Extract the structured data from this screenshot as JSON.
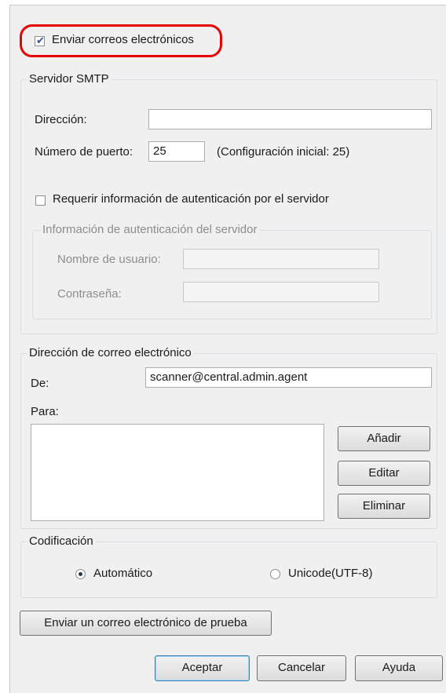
{
  "send_emails": {
    "label": "Enviar correos electrónicos",
    "checked": true
  },
  "smtp": {
    "title": "Servidor SMTP",
    "address_label": "Dirección:",
    "address_value": "",
    "port_label": "Número de puerto:",
    "port_value": "25",
    "port_hint": "(Configuración inicial: 25)",
    "require_auth_label": "Requerir información de autenticación por el servidor",
    "require_auth_checked": false,
    "auth": {
      "title": "Información de autenticación del servidor",
      "username_label": "Nombre de usuario:",
      "username_value": "",
      "password_label": "Contraseña:",
      "password_value": ""
    }
  },
  "email": {
    "title": "Dirección de correo electrónico",
    "from_label": "De:",
    "from_value": "scanner@central.admin.agent",
    "to_label": "Para:",
    "to_items": [],
    "add_button": "Añadir",
    "edit_button": "Editar",
    "delete_button": "Eliminar"
  },
  "encoding": {
    "title": "Codificación",
    "options": [
      {
        "label": "Automático",
        "selected": true
      },
      {
        "label": "Unicode(UTF-8)",
        "selected": false
      }
    ]
  },
  "test_button": "Enviar un correo electrónico de prueba",
  "footer": {
    "ok": "Aceptar",
    "cancel": "Cancelar",
    "help": "Ayuda"
  },
  "colors": {
    "highlight": "#e60000",
    "dialog_bg": "#f0f0f0",
    "default_button_border": "#3c7fb1"
  }
}
